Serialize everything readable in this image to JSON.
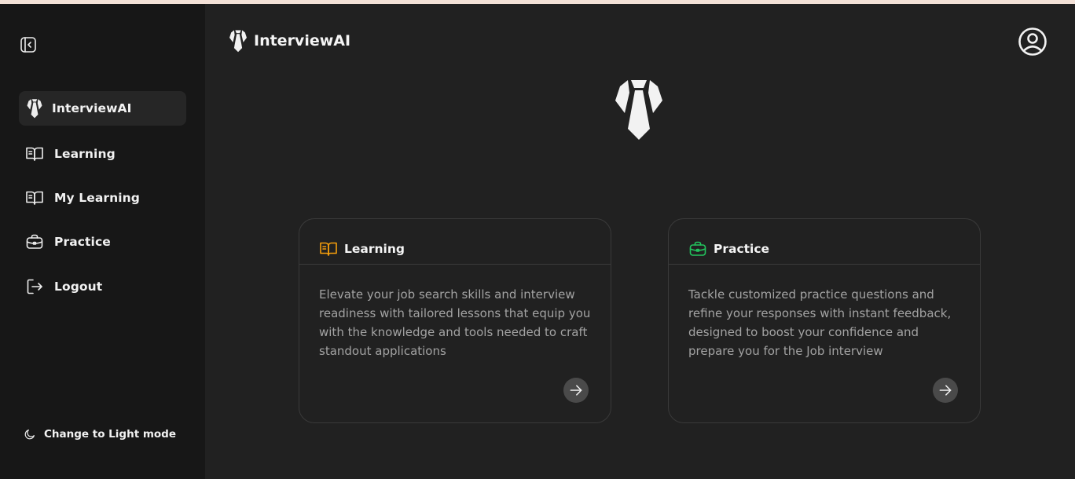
{
  "brand": {
    "name": "InterviewAI"
  },
  "sidebar": {
    "items": [
      {
        "label": "InterviewAI",
        "icon": "tie-logo-icon",
        "active": true
      },
      {
        "label": "Learning",
        "icon": "book-icon"
      },
      {
        "label": "My Learning",
        "icon": "book-icon"
      },
      {
        "label": "Practice",
        "icon": "briefcase-icon"
      },
      {
        "label": "Logout",
        "icon": "logout-icon"
      }
    ],
    "theme_toggle": {
      "label": "Change to Light mode",
      "icon": "moon-icon"
    }
  },
  "cards": [
    {
      "title": "Learning",
      "icon": "book-icon",
      "icon_color": "#f59e0b",
      "description": "Elevate your job search skills and interview readiness with tailored lessons that equip you with the knowledge and tools needed to craft standout applications"
    },
    {
      "title": "Practice",
      "icon": "briefcase-icon",
      "icon_color": "#22c55e",
      "description": "Tackle customized practice questions and refine your responses with instant feedback, designed to boost your confidence and prepare you for the Job interview"
    }
  ],
  "colors": {
    "background": "#212121",
    "sidebar": "#171717",
    "learning_accent": "#f59e0b",
    "practice_accent": "#22c55e"
  }
}
